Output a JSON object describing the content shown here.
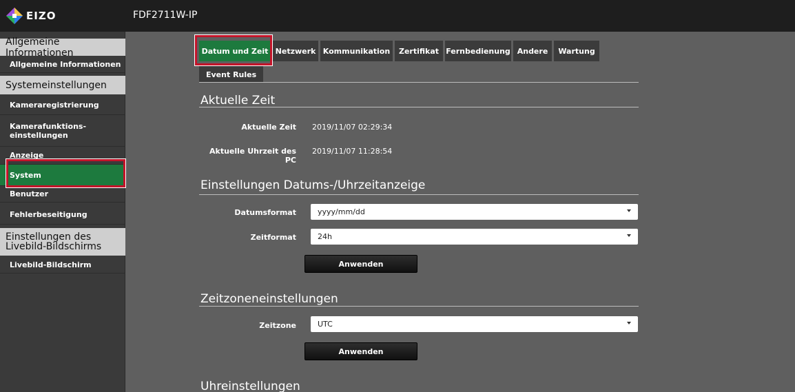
{
  "header": {
    "logo_text": "EIZO",
    "model": "FDF2711W-IP"
  },
  "sidebar": {
    "sections": [
      {
        "label": "Allgemeine Informationen"
      },
      {
        "label": "Systemeinstellungen"
      },
      {
        "label": "Einstellungen des Livebild-Bildschirms"
      }
    ],
    "items": [
      {
        "label": "Allgemeine Informationen"
      },
      {
        "label": "Kameraregistrierung"
      },
      {
        "label": "Kamerafunktions-einstellungen"
      },
      {
        "label": "Anzeige"
      },
      {
        "label": "System"
      },
      {
        "label": "Benutzer"
      },
      {
        "label": "Fehlerbeseitigung"
      },
      {
        "label": "Livebild-Bildschirm"
      }
    ]
  },
  "tabs": [
    "Datum und Zeit",
    "Netzwerk",
    "Kommunikation",
    "Zertifikat",
    "Fernbedienung",
    "Andere",
    "Wartung"
  ],
  "tab_row2": "Event Rules",
  "sections": {
    "current_time": {
      "title": "Aktuelle Zeit",
      "current_time_label": "Aktuelle Zeit",
      "current_time_value": "2019/11/07 02:29:34",
      "pc_time_label": "Aktuelle Uhrzeit des PC",
      "pc_time_value": "2019/11/07 11:28:54"
    },
    "display_settings": {
      "title": "Einstellungen Datums-/Uhrzeitanzeige",
      "date_format_label": "Datumsformat",
      "date_format_value": "yyyy/mm/dd",
      "time_format_label": "Zeitformat",
      "time_format_value": "24h",
      "apply_label": "Anwenden"
    },
    "timezone": {
      "title": "Zeitzoneneinstellungen",
      "timezone_label": "Zeitzone",
      "timezone_value": "UTC",
      "apply_label": "Anwenden"
    },
    "clock": {
      "title": "Uhreinstellungen"
    }
  },
  "colors": {
    "accent_green": "#1d7a3e",
    "highlight_red": "#c4142a"
  }
}
